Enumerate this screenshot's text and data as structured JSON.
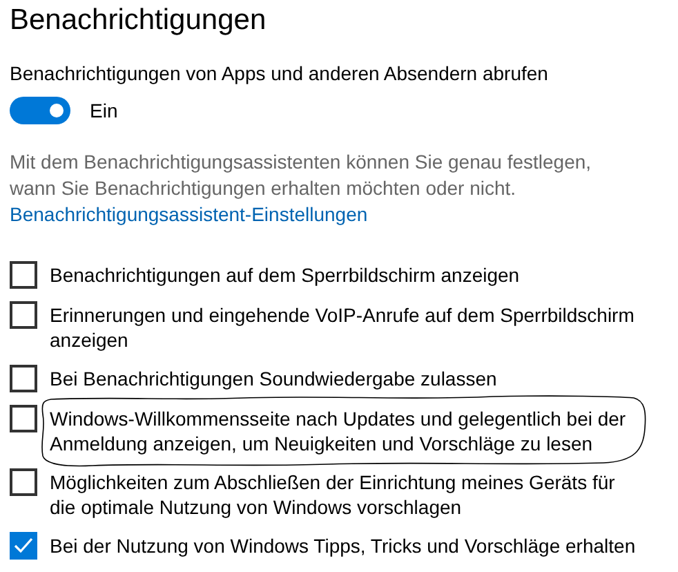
{
  "page": {
    "title": "Benachrichtigungen"
  },
  "main_setting": {
    "label": "Benachrichtigungen von Apps und anderen Absendern abrufen",
    "on": true,
    "state_label": "Ein"
  },
  "description": "Mit dem Benachrichtigungsassistenten können Sie genau festlegen, wann Sie Benachrichtigungen erhalten möchten oder nicht.",
  "link": "Benachrichtigungsassistent-Einstellungen",
  "options": [
    {
      "label": "Benachrichtigungen auf dem Sperrbildschirm anzeigen",
      "checked": false
    },
    {
      "label": "Erinnerungen und eingehende VoIP-Anrufe auf dem Sperrbildschirm anzeigen",
      "checked": false
    },
    {
      "label": "Bei Benachrichtigungen Soundwiedergabe zulassen",
      "checked": false
    },
    {
      "label": "Windows-Willkommensseite nach Updates und gelegentlich bei der Anmeldung anzeigen, um Neuigkeiten und Vorschläge zu lesen",
      "checked": false,
      "circled": true
    },
    {
      "label": "Möglichkeiten zum Abschließen der Einrichtung meines Geräts für die optimale Nutzung von Windows vorschlagen",
      "checked": false
    },
    {
      "label": "Bei der Nutzung von Windows Tipps, Tricks und Vorschläge erhalten",
      "checked": true
    }
  ]
}
